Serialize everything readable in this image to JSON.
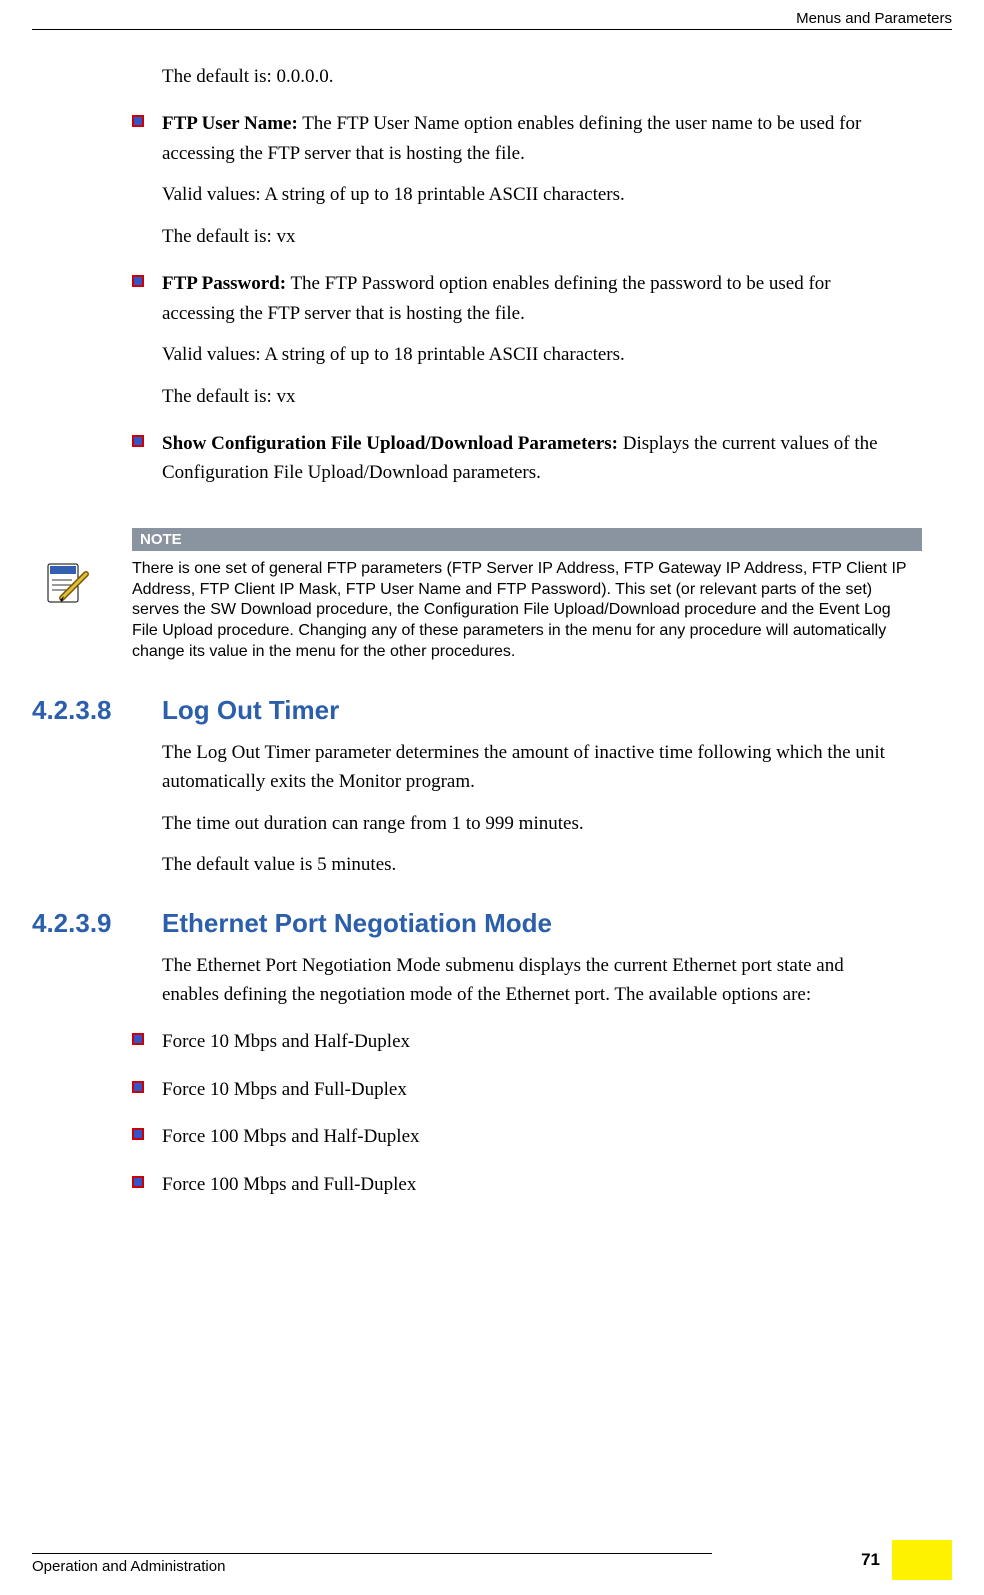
{
  "header": {
    "right": "Menus and Parameters"
  },
  "intro": {
    "default_ip": "The default is: 0.0.0.0."
  },
  "bullets_top": [
    {
      "label": "FTP User Name:",
      "desc": " The FTP User Name option enables defining the user name to be used for accessing the FTP server that is hosting the file.",
      "valid": "Valid values: A string of up to 18 printable ASCII characters.",
      "default": "The default is: vx"
    },
    {
      "label": "FTP Password:",
      "desc": " The FTP Password option enables defining the password to be used for accessing the FTP server that is hosting the file.",
      "valid": "Valid values: A string of up to 18 printable ASCII characters.",
      "default": "The default is: vx"
    },
    {
      "label": "Show Configuration File Upload/Download Parameters:",
      "desc": " Displays the current values of the Configuration File Upload/Download parameters."
    }
  ],
  "note": {
    "title": "NOTE",
    "body": "There is one set of general FTP parameters (FTP Server IP Address, FTP Gateway IP Address, FTP Client IP Address, FTP Client IP Mask, FTP User Name and FTP Password). This set (or relevant parts of the set) serves the SW Download procedure, the Configuration File Upload/Download procedure and the Event Log File Upload procedure. Changing any of these parameters in the menu for any procedure will automatically change its value in the menu for the other procedures."
  },
  "sections": [
    {
      "num": "4.2.3.8",
      "title": "Log Out Timer",
      "paras": [
        "The Log Out Timer parameter determines the amount of inactive time following which the unit automatically exits the Monitor program.",
        "The time out duration can range from 1 to 999 minutes.",
        "The default value is 5 minutes."
      ]
    },
    {
      "num": "4.2.3.9",
      "title": "Ethernet Port Negotiation Mode",
      "paras": [
        "The Ethernet Port Negotiation Mode submenu displays the current Ethernet port state and enables defining the negotiation mode of the Ethernet port. The available options are:"
      ],
      "options": [
        "Force 10 Mbps and Half-Duplex",
        "Force 10 Mbps and Full-Duplex",
        "Force 100 Mbps and Half-Duplex",
        "Force 100 Mbps and Full-Duplex"
      ]
    }
  ],
  "footer": {
    "left": "Operation and Administration",
    "page": "71"
  }
}
